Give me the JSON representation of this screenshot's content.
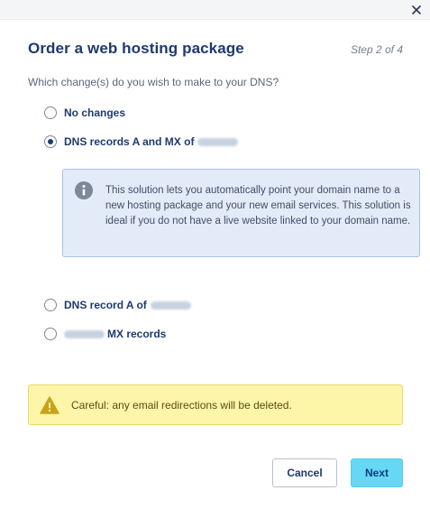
{
  "dialog": {
    "title": "Order a web hosting package",
    "step": "Step 2 of 4",
    "close_icon": "close-icon"
  },
  "question": "Which change(s) do you wish to make to your DNS?",
  "options": [
    {
      "label": "No changes",
      "selected": false
    },
    {
      "label": "DNS records A and MX of",
      "selected": true
    },
    {
      "label": "DNS record A of",
      "selected": false
    },
    {
      "label": "MX records",
      "selected": false
    }
  ],
  "info": {
    "icon": "info-icon",
    "text": "This solution lets you automatically point your domain name to a new hosting package and your new email services. This solution is ideal if you do not have a live website linked to your domain name."
  },
  "warning": {
    "icon": "warning-icon",
    "text": "Careful: any email redirections will be deleted."
  },
  "buttons": {
    "cancel": "Cancel",
    "next": "Next"
  },
  "colors": {
    "title": "#1d3a6e",
    "info_bg": "#e4ebf8",
    "warning_bg": "#fdf6a8",
    "next_bg": "#66d7f4"
  }
}
